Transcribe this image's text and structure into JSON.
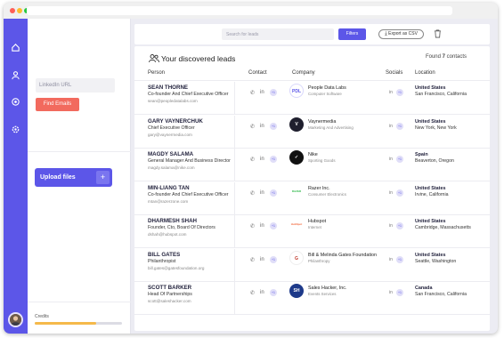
{
  "sidebar": {
    "linkedin_placeholder": "LinkedIn URL",
    "find_emails_label": "Find Emails",
    "upload_label": "Upload files",
    "upload_plus": "+",
    "credits_label": "Credits",
    "credits_fraction": 0.7
  },
  "toolbar": {
    "search_placeholder": "Search for leads",
    "filters_label": "Filters",
    "export_label": "Export as CSV"
  },
  "main": {
    "title": "Your discovered leads",
    "found_prefix": "Found ",
    "found_count": "7",
    "found_suffix": " contacts",
    "columns": [
      "Person",
      "Contact",
      "Company",
      "Socials",
      "Location"
    ],
    "rows": [
      {
        "name": "SEAN THORNE",
        "title": "Co-founder And Chief Executive Officer",
        "email": "sean@peopledatalabs.com",
        "company": "People Data Labs",
        "industry": "Computer Software",
        "country": "United States",
        "city": "San Francisco, California",
        "contact_badge": "+1",
        "social_badge": "+1"
      },
      {
        "name": "GARY VAYNERCHUK",
        "title": "Chief Executive Officer",
        "email": "gary@vaynermedia.com",
        "company": "Vaynermedia",
        "industry": "Marketing And Advertising",
        "country": "United States",
        "city": "New York, New York",
        "contact_badge": "+1",
        "social_badge": "+1"
      },
      {
        "name": "MAGDY SALAMA",
        "title": "General Manager And Business Director",
        "email": "magdy.salama@nike.com",
        "company": "Nike",
        "industry": "Sporting Goods",
        "country": "Spain",
        "city": "Beaverton, Oregon",
        "contact_badge": "+1",
        "social_badge": "+1"
      },
      {
        "name": "MIN-LIANG TAN",
        "title": "Co-founder And Chief Executive Officer",
        "email": "mtan@razerzone.com",
        "company": "Razer Inc.",
        "industry": "Consumer Electronics",
        "country": "United States",
        "city": "Irvine, California",
        "contact_badge": "+1",
        "social_badge": "+1"
      },
      {
        "name": "DHARMESH SHAH",
        "title": "Founder, Cto, Board Of Directors",
        "email": "dshah@hubspot.com",
        "company": "Hubspot",
        "industry": "Internet",
        "country": "United States",
        "city": "Cambridge, Massachusetts",
        "contact_badge": "+1",
        "social_badge": "+1"
      },
      {
        "name": "BILL GATES",
        "title": "Philanthropist",
        "email": "bill.gates@gatesfoundation.org",
        "company": "Bill & Melinda Gates Foundation",
        "industry": "Philanthropy",
        "country": "United States",
        "city": "Seattle, Washington",
        "contact_badge": "+1",
        "social_badge": "+1"
      },
      {
        "name": "SCOTT BARKER",
        "title": "Head Of Partnerships",
        "email": "scott@saleshacker.com",
        "company": "Sales Hacker, Inc.",
        "industry": "Events Services",
        "country": "Canada",
        "city": "San Francisco, California",
        "contact_badge": "+1",
        "social_badge": "+1"
      }
    ],
    "logos": [
      "PDL",
      "V",
      "✓",
      "RAZER",
      "HubSpot",
      "G",
      "SH"
    ]
  },
  "colors": {
    "accent": "#5c56e8",
    "danger": "#f26a5e",
    "credits": "#f5b94a"
  }
}
